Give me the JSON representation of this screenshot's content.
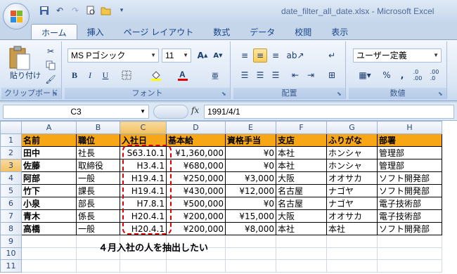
{
  "window": {
    "title": "date_filter_all_date.xlsx - Microsoft Excel"
  },
  "tabs": [
    "ホーム",
    "挿入",
    "ページ レイアウト",
    "数式",
    "データ",
    "校閲",
    "表示"
  ],
  "ribbon": {
    "clipboard": {
      "label": "クリップボード",
      "paste_label": "貼り付け"
    },
    "font": {
      "label": "フォント",
      "name": "MS Pゴシック",
      "size": "11"
    },
    "alignment": {
      "label": "配置"
    },
    "number": {
      "label": "数値",
      "format": "ユーザー定義"
    }
  },
  "formula_bar": {
    "name_box": "C3",
    "fx": "fx",
    "formula": "1991/4/1"
  },
  "columns": [
    "A",
    "B",
    "C",
    "D",
    "E",
    "F",
    "G",
    "H"
  ],
  "rows": [
    "1",
    "2",
    "3",
    "4",
    "5",
    "6",
    "7",
    "8",
    "9",
    "10",
    "11"
  ],
  "header": [
    "名前",
    "職位",
    "入社日",
    "基本給",
    "資格手当",
    "支店",
    "ふりがな",
    "部署"
  ],
  "data": [
    [
      "田中",
      "社長",
      "S63.10.1",
      "¥1,360,000",
      "¥0",
      "本社",
      "ホンシャ",
      "管理部"
    ],
    [
      "佐藤",
      "取締役",
      "H3.4.1",
      "¥680,000",
      "¥0",
      "本社",
      "ホンシャ",
      "管理部"
    ],
    [
      "阿部",
      "一般",
      "H19.4.1",
      "¥250,000",
      "¥3,000",
      "大阪",
      "オオサカ",
      "ソフト開発部"
    ],
    [
      "竹下",
      "課長",
      "H19.4.1",
      "¥430,000",
      "¥12,000",
      "名古屋",
      "ナゴヤ",
      "ソフト開発部"
    ],
    [
      "小泉",
      "部長",
      "H7.8.1",
      "¥500,000",
      "¥0",
      "名古屋",
      "ナゴヤ",
      "電子技術部"
    ],
    [
      "青木",
      "係長",
      "H20.4.1",
      "¥200,000",
      "¥15,000",
      "大阪",
      "オオサカ",
      "電子技術部"
    ],
    [
      "高橋",
      "一般",
      "H20.4.1",
      "¥200,000",
      "¥8,000",
      "本社",
      "本社",
      "ソフト開発部"
    ]
  ],
  "note": "４月入社の人を抽出したい",
  "colors": {
    "header_fill": "#f7a615",
    "annotation": "#e00000"
  }
}
